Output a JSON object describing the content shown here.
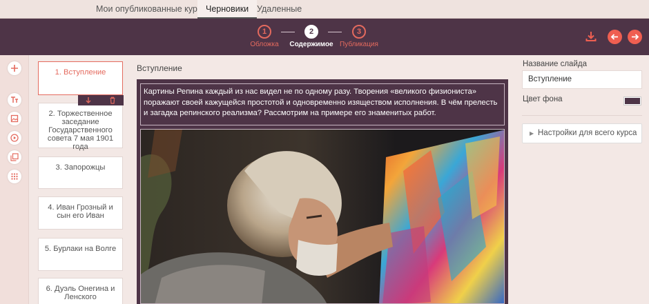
{
  "tabs": {
    "published": "Мои опубликованные курсы",
    "drafts": "Черновики",
    "deleted": "Удаленные"
  },
  "steps": [
    {
      "number": "1",
      "label": "Обложка"
    },
    {
      "number": "2",
      "label": "Содержимое"
    },
    {
      "number": "3",
      "label": "Публикация"
    }
  ],
  "slides": [
    {
      "label": "1. Вступление"
    },
    {
      "label": "2. Торжественное заседание Государственного совета 7 мая 1901 года"
    },
    {
      "label": "3. Запорожцы"
    },
    {
      "label": "4. Иван Грозный и сын его Иван"
    },
    {
      "label": "5. Бурлаки на Волге"
    },
    {
      "label": "6. Дуэль Онегина и Ленского"
    }
  ],
  "main": {
    "slide_title": "Вступление",
    "body_text": "Картины Репина каждый из нас видел не по одному разу. Творения «великого физиониста» поражают своей кажущейся простотой и одновременно изяществом исполнения. В чём прелесть и загадка репинского реализма? Рассмотрим на примере его знаменитых работ."
  },
  "right": {
    "slide_name_label": "Название слайда",
    "slide_name_value": "Вступление",
    "bg_color_label": "Цвет фона",
    "bg_color_value": "#4e3447",
    "course_settings_label": "Настройки для всего курса"
  },
  "colors": {
    "accent": "#e46a5e",
    "header": "#4e3447",
    "background": "#f3e8e5"
  }
}
